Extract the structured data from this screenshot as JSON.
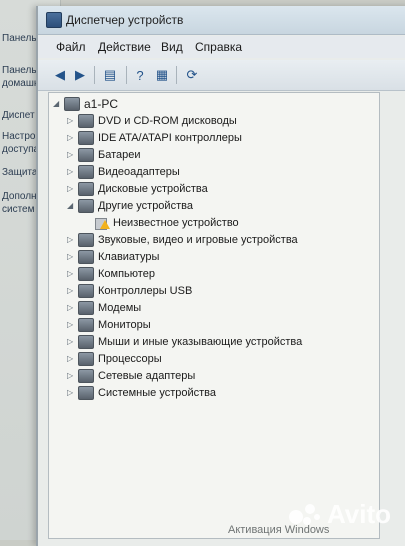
{
  "background_window": {
    "lines": [
      "Панель",
      "домашн",
      "Диспет",
      "Настро",
      "доступа",
      "Защита",
      "Дополн",
      "систем"
    ]
  },
  "window": {
    "title": "Диспетчер устройств"
  },
  "menu": {
    "items": [
      "Файл",
      "Действие",
      "Вид",
      "Справка"
    ]
  },
  "toolbar": {
    "buttons": [
      "back-icon",
      "forward-icon",
      "properties-icon",
      "help-icon",
      "view-icon",
      "scan-hardware-icon"
    ]
  },
  "tree": {
    "root": "a1-PC",
    "categories": [
      {
        "label": "DVD и CD-ROM дисководы",
        "expanded": false
      },
      {
        "label": "IDE ATA/ATAPI контроллеры",
        "expanded": false
      },
      {
        "label": "Батареи",
        "expanded": false
      },
      {
        "label": "Видеоадаптеры",
        "expanded": false
      },
      {
        "label": "Дисковые устройства",
        "expanded": false
      },
      {
        "label": "Другие устройства",
        "expanded": true
      },
      {
        "label": "Неизвестное устройство",
        "child": true,
        "warning": true
      },
      {
        "label": "Звуковые, видео и игровые устройства",
        "expanded": false
      },
      {
        "label": "Клавиатуры",
        "expanded": false
      },
      {
        "label": "Компьютер",
        "expanded": false
      },
      {
        "label": "Контроллеры USB",
        "expanded": false
      },
      {
        "label": "Модемы",
        "expanded": false
      },
      {
        "label": "Мониторы",
        "expanded": false
      },
      {
        "label": "Мыши и иные указывающие устройства",
        "expanded": false
      },
      {
        "label": "Процессоры",
        "expanded": false
      },
      {
        "label": "Сетевые адаптеры",
        "expanded": false
      },
      {
        "label": "Системные устройства",
        "expanded": false
      }
    ]
  },
  "watermark": "Активация Windows",
  "avito_logo": "Avito"
}
